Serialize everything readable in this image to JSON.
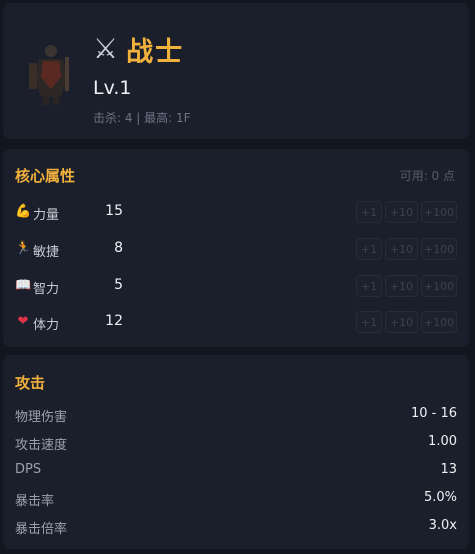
{
  "hero": {
    "title_icon": "crossed-swords-icon",
    "title_glyph": "⚔",
    "name": "战士",
    "level": "Lv.1",
    "subline": "击杀: 4 | 最高: 1F"
  },
  "attributes": {
    "title": "核心属性",
    "available": "可用: 0 点",
    "buttons": {
      "b1": "+1",
      "b10": "+10",
      "b100": "+100"
    },
    "rows": [
      {
        "icon": "flexed-biceps-icon",
        "glyph": "💪",
        "label": "力量",
        "value": "15"
      },
      {
        "icon": "running-person-icon",
        "glyph": "🏃",
        "label": "敏捷",
        "value": "8"
      },
      {
        "icon": "book-icon",
        "glyph": "📖",
        "label": "智力",
        "value": "5"
      },
      {
        "icon": "heart-icon",
        "glyph": "❤",
        "label": "体力",
        "value": "12"
      }
    ]
  },
  "combat": {
    "title": "攻击",
    "rows": [
      {
        "label": "物理伤害",
        "value": "10 - 16"
      },
      {
        "label": "攻击速度",
        "value": "1.00"
      },
      {
        "label": "DPS",
        "value": "13"
      },
      {
        "label": "暴击率",
        "value": "5.0%"
      },
      {
        "label": "暴击倍率",
        "value": "3.0x"
      }
    ]
  },
  "colors": {
    "accent": "#f2b13c",
    "panel": "#1a1f2b",
    "background": "#12161f"
  }
}
